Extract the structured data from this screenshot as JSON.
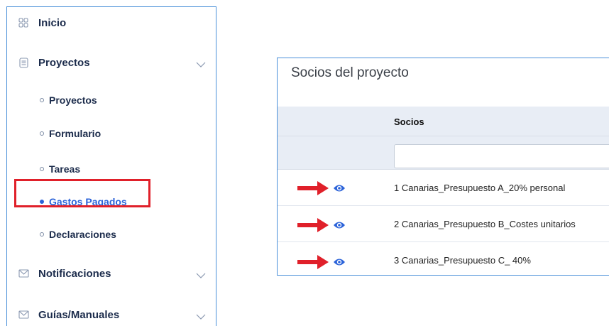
{
  "sidebar": {
    "items": [
      {
        "label": "Inicio",
        "icon": "grid-icon"
      },
      {
        "label": "Proyectos",
        "icon": "document-list-icon",
        "has_chevron": true
      },
      {
        "label": "Notificaciones",
        "icon": "envelope-icon",
        "has_chevron": true
      },
      {
        "label": "Guías/Manuales",
        "icon": "envelope-icon",
        "has_chevron": true
      }
    ],
    "sub_items": [
      {
        "label": "Proyectos",
        "active": false
      },
      {
        "label": "Formulario",
        "active": false
      },
      {
        "label": "Tareas",
        "active": false
      },
      {
        "label": "Gastos Pagados",
        "active": true
      },
      {
        "label": "Declaraciones",
        "active": false
      }
    ]
  },
  "panel": {
    "title": "Socios del proyecto",
    "column_header": "Socios",
    "filter_value": "",
    "rows": [
      {
        "label": "1 Canarias_Presupuesto A_20% personal"
      },
      {
        "label": "2 Canarias_Presupuesto B_Costes unitarios"
      },
      {
        "label": "3 Canarias_Presupuesto C_ 40%"
      }
    ]
  },
  "colors": {
    "accent": "#2b63d9",
    "highlight": "#e0202a",
    "border": "#4a90d9",
    "table_header_bg": "#e8edf5"
  }
}
